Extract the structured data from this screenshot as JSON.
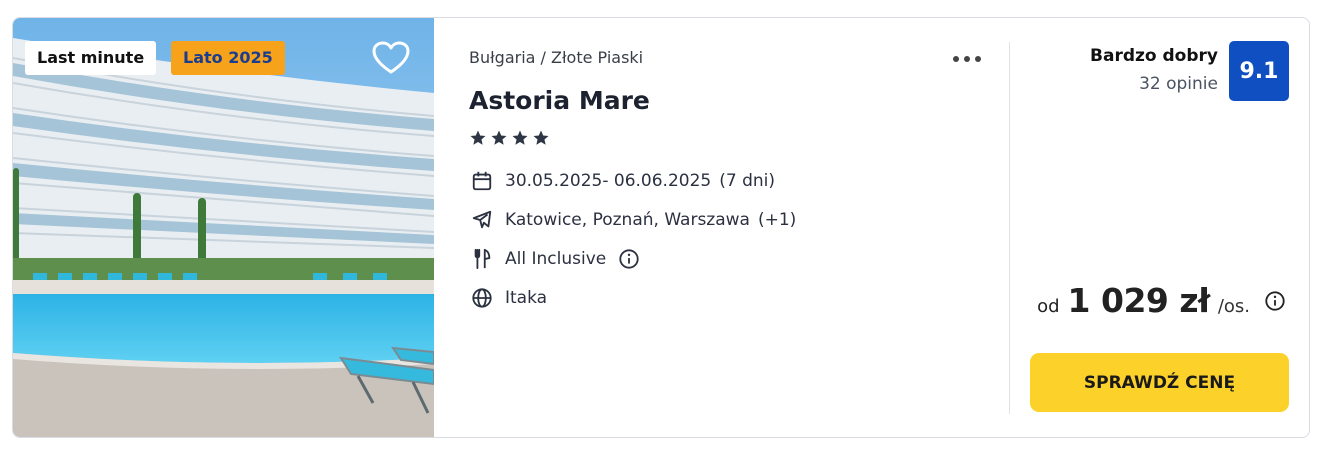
{
  "badges": {
    "last_minute": "Last minute",
    "season": "Lato 2025"
  },
  "location": "Bułgaria / Złote Piaski",
  "hotel": {
    "name": "Astoria Mare",
    "stars": 4
  },
  "details": {
    "dates": "30.05.2025- 06.06.2025",
    "duration": "(7 dni)",
    "airports": "Katowice, Poznań, Warszawa",
    "airports_more": "(+1)",
    "board": "All Inclusive",
    "operator": "Itaka"
  },
  "rating": {
    "label": "Bardzo dobry",
    "reviews": "32 opinie",
    "score": "9.1"
  },
  "price": {
    "prefix": "od",
    "amount": "1 029 zł",
    "unit": "/os."
  },
  "cta_label": "SPRAWDŹ CENĘ",
  "colors": {
    "season_badge": "#f7a21b",
    "score_badge": "#0f4fc2",
    "cta": "#fcd12a"
  }
}
